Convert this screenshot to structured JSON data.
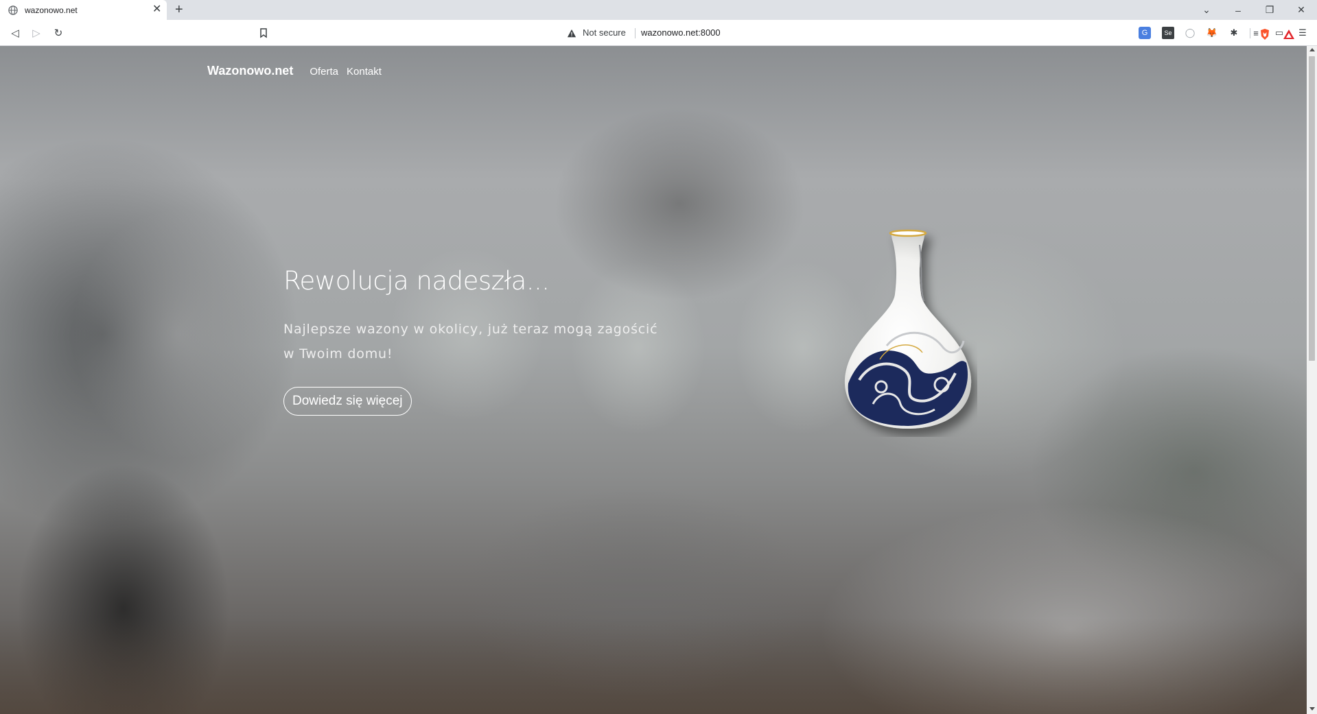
{
  "browser": {
    "tab_title": "wazonowo.net",
    "tab_close": "✕",
    "new_tab": "+",
    "window_controls": {
      "chevron": "⌄",
      "minimize": "–",
      "restore": "❐",
      "close": "✕"
    },
    "security_label": "Not secure",
    "url": "wazonowo.net:8000",
    "nav": {
      "back": "◁",
      "forward": "▷",
      "reload": "↻"
    },
    "extensions": {
      "translate": "G",
      "selenium": "Se",
      "circle": "◯",
      "fox": "🦊",
      "puzzle": "✱",
      "queue": "≡",
      "wallet": "▭",
      "menu": "☰"
    }
  },
  "site": {
    "brand": "Wazonowo.net",
    "nav": {
      "offer": "Oferta",
      "contact": "Kontakt"
    },
    "hero": {
      "title": "Rewolucja nadeszła...",
      "subtitle": "Najlepsze wazony w okolicy, już teraz mogą zagościć w Twoim domu!",
      "button": "Dowiedz się więcej"
    }
  },
  "colors": {
    "chrome_tabstrip": "#dee1e6",
    "chrome_toolbar": "#ffffff",
    "hero_text": "#ffffff",
    "vase_blue": "#1b2a5c",
    "vase_gold": "#d4a940"
  }
}
